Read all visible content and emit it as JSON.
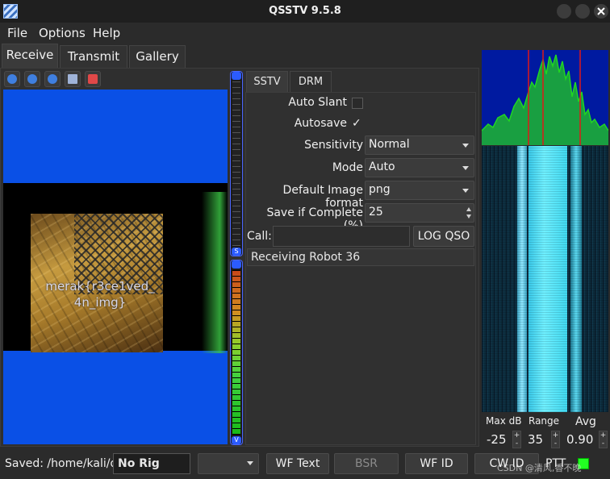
{
  "window": {
    "title": "QSSTV 9.5.8"
  },
  "menu": [
    "File",
    "Options",
    "Help"
  ],
  "tabs": [
    {
      "label": "Receive"
    },
    {
      "label": "Transmit"
    },
    {
      "label": "Gallery"
    }
  ],
  "toolbar": [
    "start-icon",
    "stop-icon",
    "refresh-icon",
    "save-icon",
    "erase-icon"
  ],
  "image": {
    "overlay_line1": "merak{r3ce1ved_",
    "overlay_line2": "4n_img}"
  },
  "meters": {
    "sync_cap": "S",
    "vu_cap": "V"
  },
  "mode_tabs": [
    "SSTV",
    "DRM"
  ],
  "settings": {
    "auto_slant_label": "Auto Slant",
    "auto_slant_checked": false,
    "autosave_label": "Autosave",
    "autosave_check": "✓",
    "sensitivity_label": "Sensitivity",
    "sensitivity_value": "Normal",
    "mode_label": "Mode",
    "mode_value": "Auto",
    "image_format_label": "Default Image format",
    "image_format_value": "png",
    "save_if_complete_label": "Save if Complete (%)",
    "save_if_complete_value": "25",
    "call_label": "Call:",
    "call_value": "",
    "log_qso_label": "LOG QSO",
    "status": "Receiving Robot 36"
  },
  "waterfall_controls": {
    "max_db_label": "Max dB",
    "max_db_value": "-25",
    "range_label": "Range",
    "range_value": "35",
    "avg_label": "Avg",
    "avg_value": "0.90",
    "spin_up": "+",
    "spin_down": "-"
  },
  "statusbar": {
    "saved": "Saved: /home/kali/q",
    "rig": "No Rig",
    "rig_select": "",
    "wf_text": "WF Text",
    "bsr": "BSR",
    "wf_id": "WF ID",
    "cw_id": "CW ID",
    "ptt": "PTT"
  },
  "watermark": "CSDN @清风,香不晚",
  "colors": {
    "accent_blue": "#0a50e6",
    "ptt_green": "#22ff22",
    "spectrum_bg": "#001aa0",
    "marker_red": "#e01818"
  }
}
